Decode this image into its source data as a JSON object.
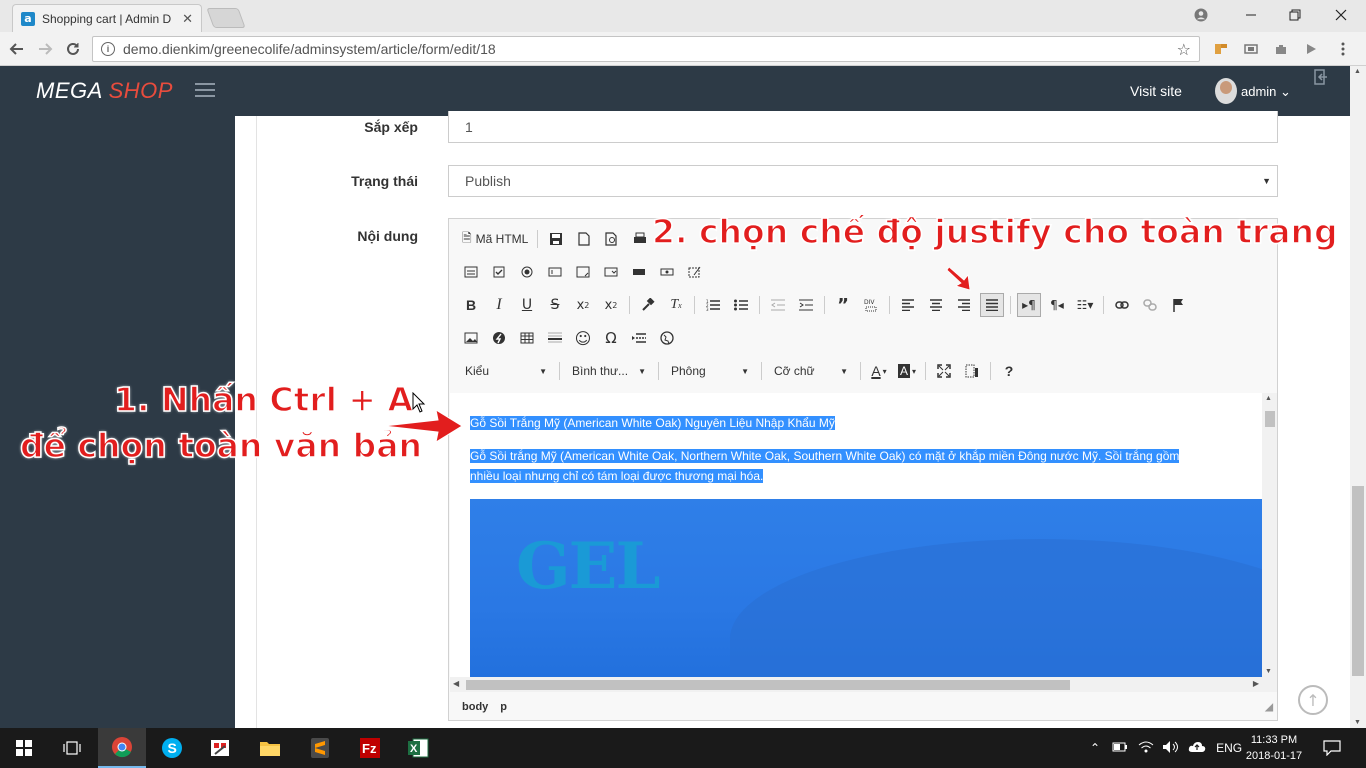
{
  "browser": {
    "tab_title": "Shopping cart | Admin D",
    "tab_icon": "a",
    "tab_close": "✕",
    "url": "demo.dienkim/greenecolife/adminsystem/article/form/edit/18"
  },
  "header": {
    "brand_primary": "MEGA",
    "brand_accent": "SHOP",
    "visit_site": "Visit site",
    "user": "admin",
    "user_caret": "⌄"
  },
  "form": {
    "sort_label": "Sắp xếp",
    "sort_value": "1",
    "status_label": "Trạng thái",
    "status_value": "Publish",
    "content_label": "Nội dung"
  },
  "editor": {
    "source_button": "Mã HTML",
    "style_combo": "Kiểu",
    "format_combo": "Bình thư...",
    "font_combo": "Phông",
    "size_combo": "Cỡ chữ",
    "help": "?",
    "heading_text": "Gỗ Sồi Trắng Mỹ (American White Oak) Nguyên Liệu Nhập Khẩu Mỹ",
    "para_line1": "Gỗ Sồi trắng Mỹ (American White Oak, Northern White Oak, Southern White Oak) có mặt ở khắp miền Đông nước Mỹ. Sồi trắng gồm",
    "para_line2": "nhiều loại nhưng chỉ có tám loại được thương mại hóa.",
    "image_logo": "GEL",
    "path_body": "body",
    "path_p": "p"
  },
  "annotations": {
    "step1_line1": "1. Nhấn Ctrl + A",
    "step1_line2": "để chọn toàn văn bản",
    "step2": "2. chọn chế độ justify cho toàn trang"
  },
  "taskbar": {
    "lang": "ENG",
    "time": "11:33 PM",
    "date": "2018-01-17"
  },
  "colors": {
    "header_bg": "#2d3a46",
    "brand_accent": "#e84c3d",
    "selection": "#3390ff",
    "annotation": "#e21e1e"
  }
}
